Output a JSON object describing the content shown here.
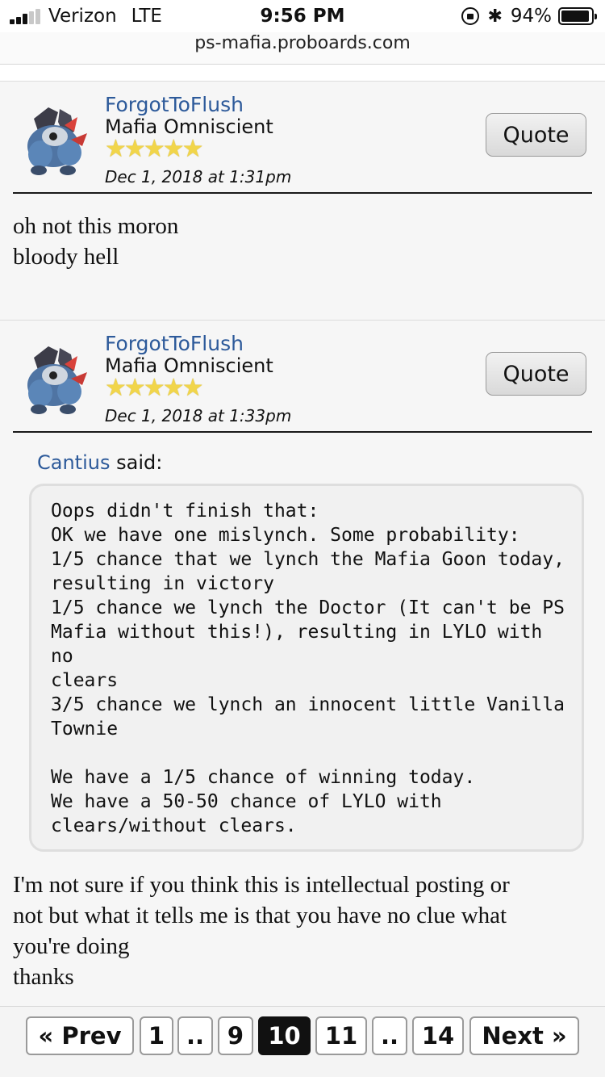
{
  "status_bar": {
    "carrier": "Verizon",
    "network": "LTE",
    "time": "9:56 PM",
    "battery": "94%",
    "battery_level": 0.94
  },
  "browser": {
    "url": "ps-mafia.proboards.com"
  },
  "posts": [
    {
      "username": "ForgotToFlush",
      "rank": "Mafia Omniscient",
      "stars": 5,
      "date": "Dec 1, 2018 at 1:31pm",
      "quote_label": "Quote",
      "body": [
        "oh not this moron",
        "bloody hell"
      ]
    },
    {
      "username": "ForgotToFlush",
      "rank": "Mafia Omniscient",
      "stars": 5,
      "date": "Dec 1, 2018 at 1:33pm",
      "quote_label": "Quote",
      "quote_author": "Cantius",
      "quote_said": "said:",
      "quote_lines": [
        "Oops didn't finish that:",
        "OK we have one mislynch. Some probability:",
        "1/5 chance that we lynch the Mafia Goon today,",
        "resulting in victory",
        "1/5 chance we lynch the Doctor (It can't be PS",
        "Mafia without this!), resulting in LYLO with no",
        "clears",
        "3/5 chance we lynch an innocent little Vanilla",
        "Townie",
        "",
        "We have a 1/5 chance of winning today.",
        "We have a 50-50 chance of LYLO with",
        "clears/without clears."
      ],
      "body": [
        "I'm not sure if you think this is intellectual posting or",
        "not but what it tells me is that you have no clue what",
        "you're doing",
        "thanks"
      ]
    }
  ],
  "pagination": {
    "prev": "« Prev",
    "pages": [
      "1",
      "..",
      "9",
      "10",
      "11",
      "..",
      "14"
    ],
    "current": "10",
    "next": "Next »"
  },
  "colors": {
    "link": "#2d5a9a",
    "star": "#f1d54a",
    "current_page_bg": "#111111"
  },
  "icons": [
    "signal-icon",
    "orientation-lock-icon",
    "bluetooth-icon",
    "battery-icon",
    "avatar-image",
    "star-icon"
  ]
}
